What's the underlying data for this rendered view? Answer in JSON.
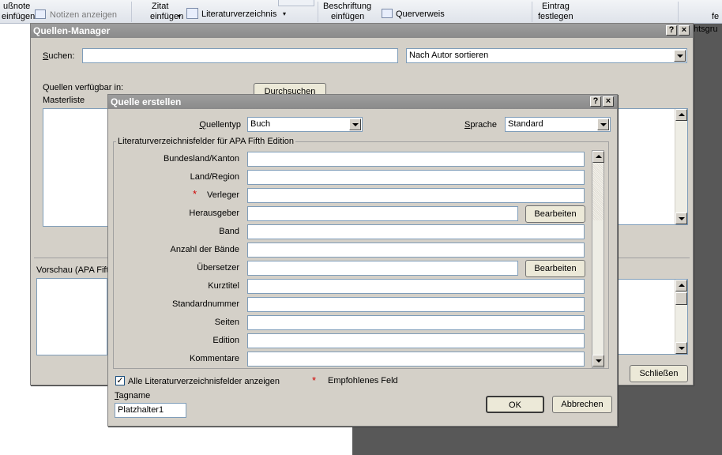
{
  "ribbon": {
    "fussnote_line1": "ußnote",
    "fussnote_line2": "einfügen",
    "notes_label": "Notizen anzeigen",
    "zitat_line1": "Zitat",
    "zitat_line2": "einfügen",
    "literatur_label": "Literaturverzeichnis",
    "beschriftung_line1": "Beschriftung",
    "beschriftung_line2": "einfügen",
    "querverweis_label": "Querverweis",
    "eintrag_line1": "Eintrag",
    "eintrag_line2": "festlegen",
    "right_line1": "fe",
    "right_line2": "htsgru"
  },
  "manager": {
    "title": "Quellen-Manager",
    "search_label": "Suchen:",
    "search_value": "",
    "sort_value": "Nach Autor sortieren",
    "available_label": "Quellen verfügbar in:",
    "masterlist_label": "Masterliste",
    "browse_label": "Durchsuchen",
    "preview_label": "Vorschau (APA Fift",
    "close_label": "Schließen"
  },
  "dialog": {
    "title": "Quelle erstellen",
    "quellentyp_label": "Quellentyp",
    "quellentyp_value": "Buch",
    "sprache_label": "Sprache",
    "sprache_value": "Standard",
    "group_label": "Literaturverzeichnisfelder für APA Fifth Edition",
    "fields": [
      {
        "label": "Bundesland/Kanton",
        "value": "",
        "star": false,
        "button": ""
      },
      {
        "label": "Land/Region",
        "value": "",
        "star": false,
        "button": ""
      },
      {
        "label": "Verleger",
        "value": "",
        "star": true,
        "button": ""
      },
      {
        "label": "Herausgeber",
        "value": "",
        "star": false,
        "button": "Bearbeiten"
      },
      {
        "label": "Band",
        "value": "",
        "star": false,
        "button": ""
      },
      {
        "label": "Anzahl der Bände",
        "value": "",
        "star": false,
        "button": ""
      },
      {
        "label": "Übersetzer",
        "value": "",
        "star": false,
        "button": "Bearbeiten"
      },
      {
        "label": "Kurztitel",
        "value": "",
        "star": false,
        "button": ""
      },
      {
        "label": "Standardnummer",
        "value": "",
        "star": false,
        "button": ""
      },
      {
        "label": "Seiten",
        "value": "",
        "star": false,
        "button": ""
      },
      {
        "label": "Edition",
        "value": "",
        "star": false,
        "button": ""
      },
      {
        "label": "Kommentare",
        "value": "",
        "star": false,
        "button": ""
      }
    ],
    "show_all_label": "Alle Literaturverzeichnisfelder anzeigen",
    "show_all_checked": "✓",
    "recommended_label": "Empfohlenes Feld",
    "tagname_label": "Tagname",
    "tagname_value": "Platzhalter1",
    "ok_label": "OK",
    "cancel_label": "Abbrechen"
  }
}
